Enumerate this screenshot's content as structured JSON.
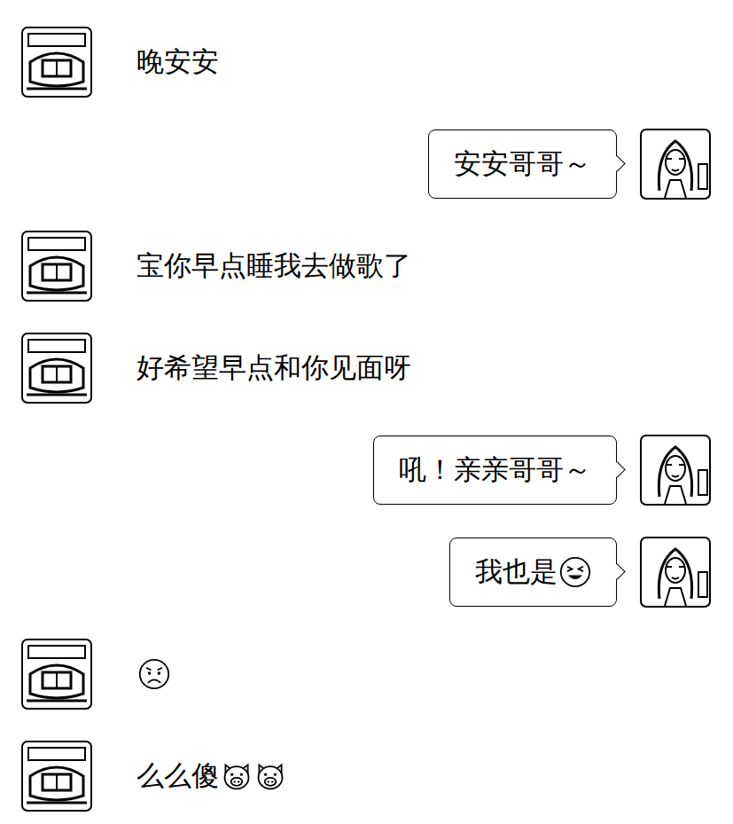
{
  "messages": [
    {
      "side": "left",
      "parts": [
        {
          "kind": "text",
          "text": "晚安安"
        }
      ]
    },
    {
      "side": "right",
      "parts": [
        {
          "kind": "text",
          "text": "安安哥哥～"
        }
      ]
    },
    {
      "side": "left",
      "parts": [
        {
          "kind": "text",
          "text": "宝你早点睡我去做歌了"
        }
      ]
    },
    {
      "side": "left",
      "parts": [
        {
          "kind": "text",
          "text": "好希望早点和你见面呀"
        }
      ]
    },
    {
      "side": "right",
      "parts": [
        {
          "kind": "text",
          "text": "吼！亲亲哥哥～"
        }
      ]
    },
    {
      "side": "right",
      "parts": [
        {
          "kind": "text",
          "text": "我也是"
        },
        {
          "kind": "laugh"
        }
      ]
    },
    {
      "side": "left",
      "parts": [
        {
          "kind": "sad"
        }
      ]
    },
    {
      "side": "left",
      "parts": [
        {
          "kind": "text",
          "text": "么么傻"
        },
        {
          "kind": "pig"
        },
        {
          "kind": "pig"
        }
      ]
    }
  ]
}
